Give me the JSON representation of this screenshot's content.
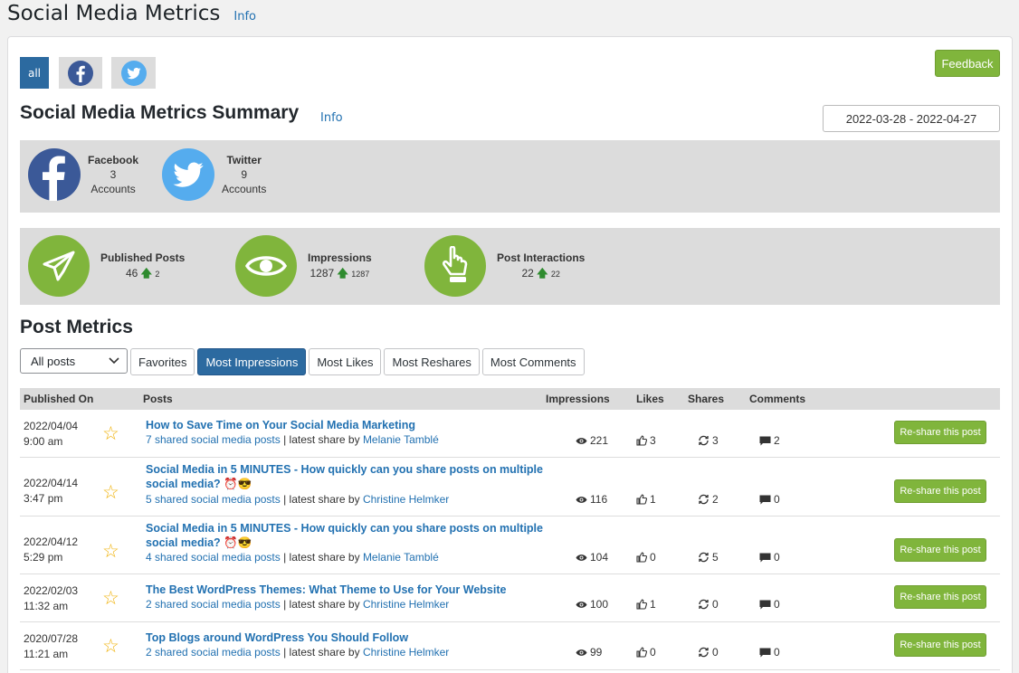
{
  "page": {
    "title": "Social Media Metrics",
    "info": "Info"
  },
  "filters": {
    "all": "all"
  },
  "feedback": "Feedback",
  "summary": {
    "title": "Social Media Metrics Summary",
    "info": "Info",
    "date_range": "2022-03-28 - 2022-04-27"
  },
  "accounts": [
    {
      "name": "Facebook",
      "count": "3",
      "label": "Accounts",
      "color": "#3b5998"
    },
    {
      "name": "Twitter",
      "count": "9",
      "label": "Accounts",
      "color": "#55acee"
    }
  ],
  "stats": [
    {
      "label": "Published Posts",
      "value": "46",
      "change": "2"
    },
    {
      "label": "Impressions",
      "value": "1287",
      "change": "1287"
    },
    {
      "label": "Post Interactions",
      "value": "22",
      "change": "22"
    }
  ],
  "post_metrics": {
    "title": "Post Metrics",
    "select_value": "All posts",
    "tabs": [
      "Favorites",
      "Most Impressions",
      "Most Likes",
      "Most Reshares",
      "Most Comments"
    ]
  },
  "table": {
    "headers": {
      "published": "Published On",
      "posts": "Posts",
      "impressions": "Impressions",
      "likes": "Likes",
      "shares": "Shares",
      "comments": "Comments"
    },
    "rows": [
      {
        "date": "2022/04/04",
        "time": "9:00 am",
        "title": "How to Save Time on Your Social Media Marketing",
        "shared": "7 shared social media posts",
        "latest_label": "| latest share by",
        "author": "Melanie Tamblé",
        "impressions": "221",
        "likes": "3",
        "shares": "3",
        "comments": "2",
        "button": "Re-share this post"
      },
      {
        "date": "2022/04/14",
        "time": "3:47 pm",
        "title": "Social Media in 5 MINUTES - How quickly can you share posts on multiple social media? ⏰😎",
        "shared": "5 shared social media posts",
        "latest_label": "| latest share by",
        "author": "Christine Helmker",
        "impressions": "116",
        "likes": "1",
        "shares": "2",
        "comments": "0",
        "button": "Re-share this post"
      },
      {
        "date": "2022/04/12",
        "time": "5:29 pm",
        "title": "Social Media in 5 MINUTES - How quickly can you share posts on multiple social media? ⏰😎",
        "shared": "4 shared social media posts",
        "latest_label": "| latest share by",
        "author": "Melanie Tamblé",
        "impressions": "104",
        "likes": "0",
        "shares": "5",
        "comments": "0",
        "button": "Re-share this post"
      },
      {
        "date": "2022/02/03",
        "time": "11:32 am",
        "title": "The Best WordPress Themes: What Theme to Use for Your Website",
        "shared": "2 shared social media posts",
        "latest_label": "| latest share by",
        "author": "Christine Helmker",
        "impressions": "100",
        "likes": "1",
        "shares": "0",
        "comments": "0",
        "button": "Re-share this post"
      },
      {
        "date": "2020/07/28",
        "time": "11:21 am",
        "title": "Top Blogs around WordPress You Should Follow",
        "shared": "2 shared social media posts",
        "latest_label": "| latest share by",
        "author": "Christine Helmker",
        "impressions": "99",
        "likes": "0",
        "shares": "0",
        "comments": "0",
        "button": "Re-share this post"
      }
    ]
  }
}
